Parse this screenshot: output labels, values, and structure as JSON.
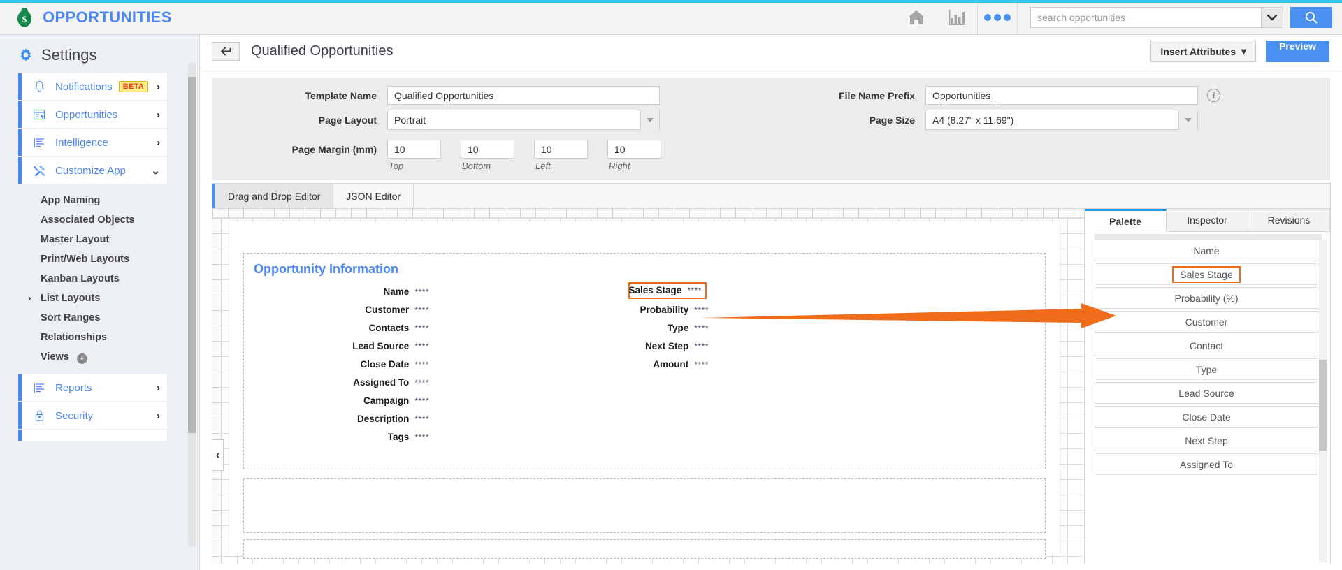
{
  "topbar": {
    "brand": "OPPORTUNITIES",
    "brand_icon": "money-bag-icon",
    "home_icon": "home-icon",
    "chart_icon": "bar-chart-icon",
    "more_icon": "more-dots-icon",
    "search_placeholder": "search opportunities",
    "search_value": "",
    "search_icon": "search-icon",
    "dropdown_icon": "chevron-down-icon",
    "accent_color": "#3ec2f0",
    "brand_color": "#4a86f7"
  },
  "sidebar": {
    "title": "Settings",
    "gear_icon": "gear-icon",
    "nav": [
      {
        "label": "Notifications",
        "icon": "bell-icon",
        "badge": "BETA",
        "chevron": "›"
      },
      {
        "label": "Opportunities",
        "icon": "window-cursor-icon",
        "badge": "",
        "chevron": "›"
      },
      {
        "label": "Intelligence",
        "icon": "list-lines-icon",
        "badge": "",
        "chevron": "›"
      },
      {
        "label": "Customize App",
        "icon": "tools-icon",
        "badge": "",
        "chevron": "⌄"
      }
    ],
    "sub_items": [
      {
        "label": "App Naming",
        "expandable": false
      },
      {
        "label": "Associated Objects",
        "expandable": false
      },
      {
        "label": "Master Layout",
        "expandable": false
      },
      {
        "label": "Print/Web Layouts",
        "expandable": false
      },
      {
        "label": "Kanban Layouts",
        "expandable": false
      },
      {
        "label": "List Layouts",
        "expandable": true
      },
      {
        "label": "Sort Ranges",
        "expandable": false
      },
      {
        "label": "Relationships",
        "expandable": false
      },
      {
        "label": "Views",
        "expandable": false,
        "plus": "+"
      }
    ],
    "nav_bottom": [
      {
        "label": "Reports",
        "icon": "list-lines-icon",
        "chevron": "›"
      },
      {
        "label": "Security",
        "icon": "lock-icon",
        "chevron": "›"
      }
    ]
  },
  "page": {
    "back_icon": "back-arrow-icon",
    "title": "Qualified Opportunities",
    "insert_attributes_label": "Insert Attributes",
    "insert_attributes_caret": "▾",
    "preview_label": "Preview"
  },
  "settings_form": {
    "template_name_label": "Template Name",
    "template_name_value": "Qualified Opportunities",
    "page_layout_label": "Page Layout",
    "page_layout_value": "Portrait",
    "page_margin_label": "Page Margin (mm)",
    "margins": [
      {
        "value": "10",
        "caption": "Top"
      },
      {
        "value": "10",
        "caption": "Bottom"
      },
      {
        "value": "10",
        "caption": "Left"
      },
      {
        "value": "10",
        "caption": "Right"
      }
    ],
    "file_name_prefix_label": "File Name Prefix",
    "file_name_prefix_value": "Opportunities_",
    "info_icon": "info-icon",
    "page_size_label": "Page Size",
    "page_size_value": "A4 (8.27\" x 11.69\")"
  },
  "editor": {
    "tabs": [
      {
        "label": "Drag and Drop Editor",
        "active": true
      },
      {
        "label": "JSON Editor",
        "active": false
      }
    ],
    "collapse_icon": "chevron-left-icon"
  },
  "canvas": {
    "section_title": "Opportunity Information",
    "left_fields": [
      {
        "label": "Name",
        "value": "****"
      },
      {
        "label": "Customer",
        "value": "****"
      },
      {
        "label": "Contacts",
        "value": "****"
      },
      {
        "label": "Lead Source",
        "value": "****"
      },
      {
        "label": "Close Date",
        "value": "****"
      },
      {
        "label": "Assigned To",
        "value": "****"
      },
      {
        "label": "Campaign",
        "value": "****"
      },
      {
        "label": "Description",
        "value": "****"
      },
      {
        "label": "Tags",
        "value": "****"
      }
    ],
    "right_fields": [
      {
        "label": "Sales Stage",
        "value": "****",
        "highlighted": true
      },
      {
        "label": "Probability",
        "value": "****",
        "highlighted": false
      },
      {
        "label": "Type",
        "value": "****",
        "highlighted": false
      },
      {
        "label": "Next Step",
        "value": "****",
        "highlighted": false
      },
      {
        "label": "Amount",
        "value": "****",
        "highlighted": false
      }
    ],
    "highlight_color": "#ef6c1a"
  },
  "right_panel": {
    "tabs": [
      {
        "label": "Palette",
        "active": true
      },
      {
        "label": "Inspector",
        "active": false
      },
      {
        "label": "Revisions",
        "active": false
      }
    ],
    "palette_items": [
      {
        "label": "Name",
        "highlighted": false
      },
      {
        "label": "Sales Stage",
        "highlighted": true
      },
      {
        "label": "Probability (%)",
        "highlighted": false
      },
      {
        "label": "Customer",
        "highlighted": false
      },
      {
        "label": "Contact",
        "highlighted": false
      },
      {
        "label": "Type",
        "highlighted": false
      },
      {
        "label": "Lead Source",
        "highlighted": false
      },
      {
        "label": "Close Date",
        "highlighted": false
      },
      {
        "label": "Next Step",
        "highlighted": false
      },
      {
        "label": "Assigned To",
        "highlighted": false
      }
    ]
  }
}
